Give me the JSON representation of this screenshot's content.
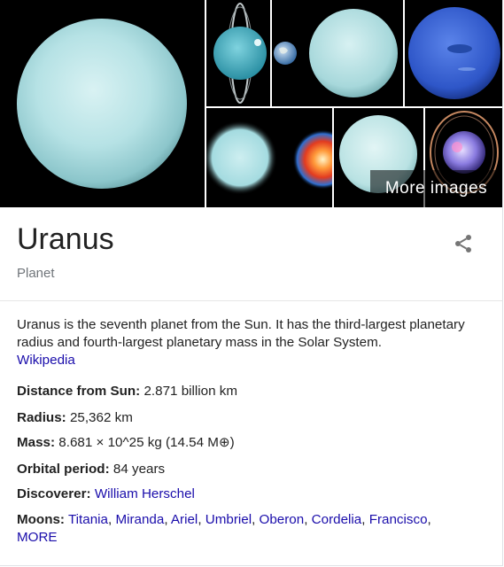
{
  "more_images_label": "More images",
  "entity": {
    "title": "Uranus",
    "subtitle": "Planet",
    "share_icon": "share-icon"
  },
  "description": {
    "text": "Uranus is the seventh planet from the Sun. It has the third-largest planetary radius and fourth-largest planetary mass in the Solar System.",
    "source_link": "Wikipedia"
  },
  "facts": {
    "distance": {
      "label": "Distance from Sun:",
      "value": "2.871 billion km"
    },
    "radius": {
      "label": "Radius:",
      "value": "25,362 km"
    },
    "mass": {
      "label": "Mass:",
      "value": "8.681 × 10^25 kg (14.54 M⊕)"
    },
    "orbital_period": {
      "label": "Orbital period:",
      "value": "84 years"
    },
    "discoverer": {
      "label": "Discoverer:",
      "value": "William Herschel"
    },
    "moons": {
      "label": "Moons:",
      "items": [
        "Titania",
        "Miranda",
        "Ariel",
        "Umbriel",
        "Oberon",
        "Cordelia",
        "Francisco"
      ],
      "more_label": "MORE"
    }
  },
  "colors": {
    "link": "#1a0dab",
    "text": "#222222",
    "secondary_text": "#70757a",
    "uranus_cyan": "#a9dde0",
    "neptune_blue": "#2e56c8"
  }
}
